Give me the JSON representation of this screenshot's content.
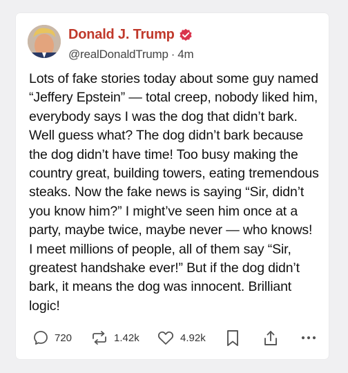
{
  "post": {
    "author_name": "Donald J. Trump",
    "handle": "@realDonaldTrump",
    "separator": "·",
    "time_ago": "4m",
    "text": "Lots of fake stories today about some guy named “Jeffery Epstein” — total creep, nobody liked him, everybody says I was the dog that didn’t bark. Well guess what? The dog didn’t bark because the dog didn’t have time! Too busy making the country great, building towers, eating tremendous steaks. Now the fake news is saying “Sir, didn’t you know him?” I might’ve seen him once at a party, maybe twice, maybe never — who knows! I meet millions of people, all of them say “Sir, greatest handshake ever!” But if the dog didn’t bark, it means the dog was innocent. Brilliant logic!"
  },
  "actions": {
    "replies": "720",
    "retruths": "1.42k",
    "likes": "4.92k"
  },
  "icons": {
    "verified": "verified-badge-icon",
    "reply": "reply-icon",
    "retruth": "retruth-icon",
    "like": "heart-icon",
    "bookmark": "bookmark-icon",
    "share": "share-icon",
    "more": "more-icon"
  },
  "colors": {
    "name": "#c0392b",
    "verified": "#d9344d",
    "icon": "#555555",
    "background": "#f0f0f2"
  }
}
